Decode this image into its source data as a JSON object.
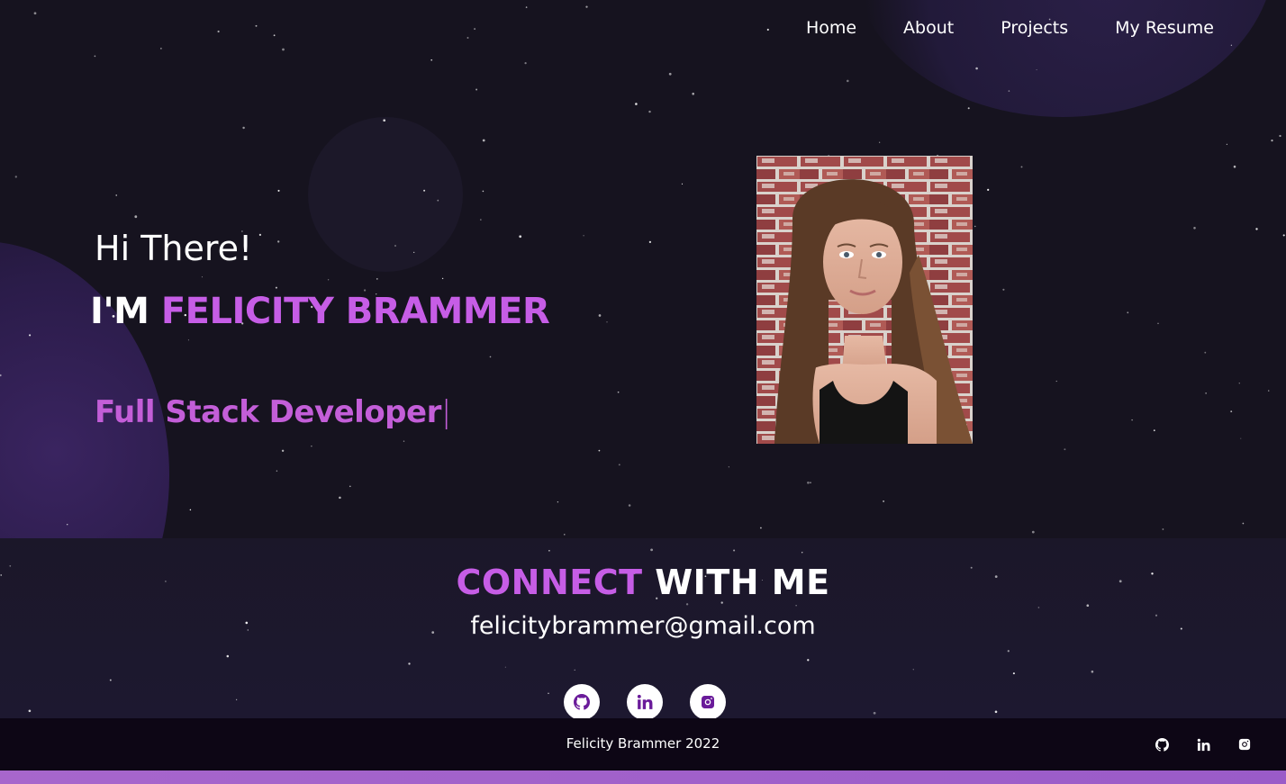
{
  "nav": {
    "items": [
      {
        "label": "Home"
      },
      {
        "label": "About"
      },
      {
        "label": "Projects"
      },
      {
        "label": "My Resume"
      }
    ]
  },
  "hero": {
    "greeting": "Hi There!",
    "intro_prefix": "I'M ",
    "name": "FELICITY BRAMMER",
    "role": "Full Stack Developer",
    "cursor": "|"
  },
  "connect": {
    "title_accent": "CONNECT",
    "title_rest": " WITH ME",
    "email": "felicitybrammer@gmail.com",
    "social_icons": [
      "github-icon",
      "linkedin-icon",
      "instagram-icon"
    ]
  },
  "footer": {
    "copyright": "Felicity Brammer 2022",
    "social_icons": [
      "github-icon",
      "linkedin-icon",
      "instagram-icon"
    ]
  },
  "colors": {
    "background": "#16131f",
    "accent": "#c65de6",
    "footer_bg": "#0d0615",
    "bottom_bar": "#a766cc",
    "icon_accent": "#6a1b9a"
  }
}
